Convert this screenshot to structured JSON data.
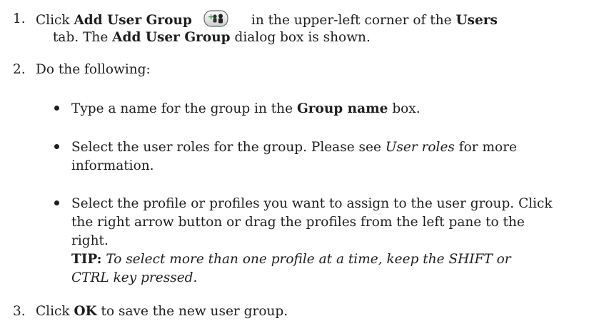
{
  "steps": [
    {
      "number": "1.",
      "pre": "Click ",
      "bold_a": "Add User Group",
      "icon": "add-user-group-icon",
      "mid": "in the upper-left corner of the ",
      "bold_b": "Users",
      "line2_pre": "tab. The ",
      "bold_c": "Add User Group",
      "line2_post": " dialog box is shown."
    },
    {
      "number": "2.",
      "text": "Do the following:"
    },
    {
      "number": "3.",
      "pre": "Click ",
      "bold": "OK",
      "post": " to save the new user group."
    }
  ],
  "bullets": [
    {
      "pre": "Type a name for the group in the ",
      "bold": "Group name",
      "post": " box."
    },
    {
      "line1": "Select the user roles for the group. Please see ",
      "italic": "User roles",
      "post": " for more",
      "line2": "information."
    },
    {
      "line1": "Select the profile or profiles you want to assign to the user group. Click",
      "line2": "the right arrow button or drag the profiles from the left pane to the",
      "line3": "right.",
      "tip_label": "TIP:",
      "tip_line1": " To select more than one profile at a time, keep the SHIFT or",
      "tip_line2": "CTRL key pressed."
    }
  ],
  "colors": {
    "text": "#1e1e1e",
    "icon_green": "#3a9a3a",
    "icon_border": "#6a6a6a"
  }
}
